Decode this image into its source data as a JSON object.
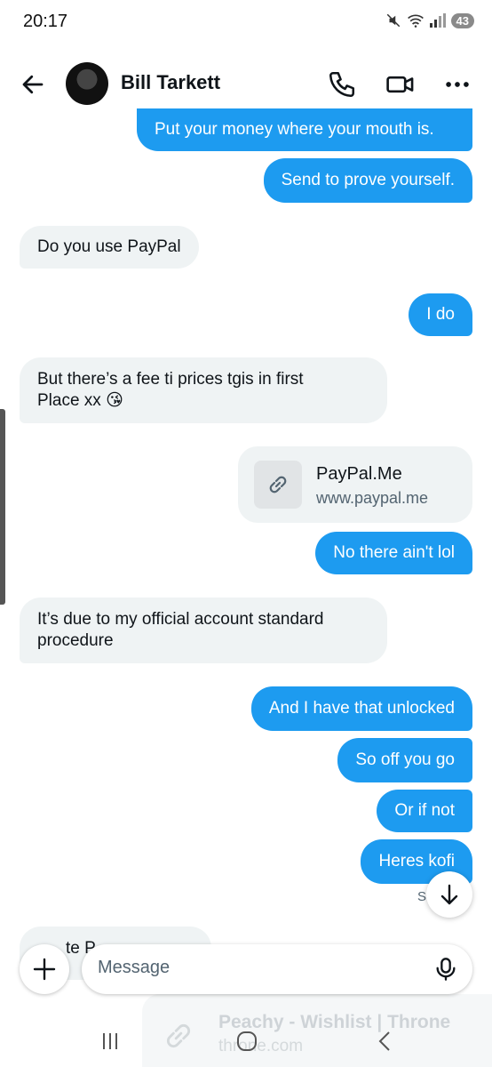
{
  "status_bar": {
    "time": "20:17",
    "battery": "43"
  },
  "header": {
    "name": "Bill Tarkett"
  },
  "messages": {
    "m1": "Put your money where your mouth is.",
    "m2": "Send to prove yourself.",
    "m3": "Do you use PayPal",
    "m4": "I do",
    "m5_line1": "But there’s a fee ti prices tgis in first",
    "m5_line2": "Place xx 😘",
    "m7": "No there ain't lol",
    "m8_line1": "It’s due to my official account standard",
    "m8_line2": "procedure",
    "m9": "And I have that unlocked",
    "m10": "So off you go",
    "m11": "Or if not",
    "m12": "Heres kofi",
    "partial": "te P"
  },
  "link_card": {
    "title": "PayPal.Me",
    "url": "www.paypal.me"
  },
  "seen_label": "S",
  "composer": {
    "placeholder": "Message"
  },
  "faded_card": {
    "title": "Peachy - Wishlist | Throne",
    "url": "throne.com"
  }
}
